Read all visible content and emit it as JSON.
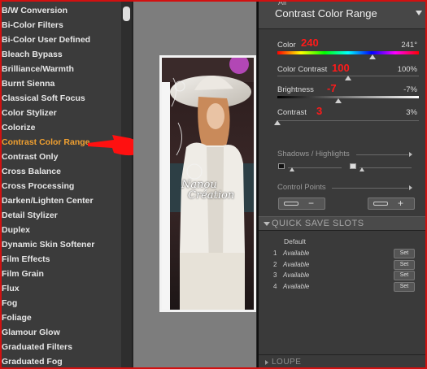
{
  "filters": {
    "items": [
      {
        "label": "B/W Conversion",
        "selected": false
      },
      {
        "label": "Bi-Color Filters",
        "selected": false
      },
      {
        "label": "Bi-Color User Defined",
        "selected": false
      },
      {
        "label": "Bleach Bypass",
        "selected": false
      },
      {
        "label": "Brilliance/Warmth",
        "selected": false
      },
      {
        "label": "Burnt Sienna",
        "selected": false
      },
      {
        "label": "Classical Soft Focus",
        "selected": false
      },
      {
        "label": "Color Stylizer",
        "selected": false
      },
      {
        "label": "Colorize",
        "selected": false
      },
      {
        "label": "Contrast Color Range",
        "selected": true
      },
      {
        "label": "Contrast Only",
        "selected": false
      },
      {
        "label": "Cross Balance",
        "selected": false
      },
      {
        "label": "Cross Processing",
        "selected": false
      },
      {
        "label": "Darken/Lighten Center",
        "selected": false
      },
      {
        "label": "Detail Stylizer",
        "selected": false
      },
      {
        "label": "Duplex",
        "selected": false
      },
      {
        "label": "Dynamic Skin Softener",
        "selected": false
      },
      {
        "label": "Film Effects",
        "selected": false
      },
      {
        "label": "Film Grain",
        "selected": false
      },
      {
        "label": "Flux",
        "selected": false
      },
      {
        "label": "Fog",
        "selected": false
      },
      {
        "label": "Foliage",
        "selected": false
      },
      {
        "label": "Glamour Glow",
        "selected": false
      },
      {
        "label": "Graduated Filters",
        "selected": false
      },
      {
        "label": "Graduated Fog",
        "selected": false
      }
    ],
    "highlight_color": "#f0a030",
    "annotation_arrow_color": "#ff1010"
  },
  "preview": {
    "watermark_lines": [
      "Nanou",
      "Création"
    ]
  },
  "panel": {
    "small_label": "All",
    "title": "Contrast Color Range",
    "params": [
      {
        "label": "Color",
        "annotation": "240",
        "value": "241°",
        "level": 0.67
      },
      {
        "label": "Color Contrast",
        "annotation": "100",
        "value": "100%",
        "level": 0.5
      },
      {
        "label": "Brightness",
        "annotation": "-7",
        "value": "-7%",
        "level": 0.43
      },
      {
        "label": "Contrast",
        "annotation": "3",
        "value": "3%",
        "level": 0.0
      }
    ],
    "shadows_label": "Shadows / Highlights",
    "control_points_label": "Control Points",
    "cp_minus": "−",
    "cp_plus": "+",
    "quick_save": {
      "title": "QUICK SAVE SLOTS",
      "default_label": "Default",
      "slots": [
        {
          "num": "1",
          "text": "Available",
          "set": "Set"
        },
        {
          "num": "2",
          "text": "Available",
          "set": "Set"
        },
        {
          "num": "3",
          "text": "Available",
          "set": "Set"
        },
        {
          "num": "4",
          "text": "Available",
          "set": "Set"
        }
      ]
    },
    "loupe_label": "LOUPE",
    "annotation_color": "#ff1a1a"
  }
}
